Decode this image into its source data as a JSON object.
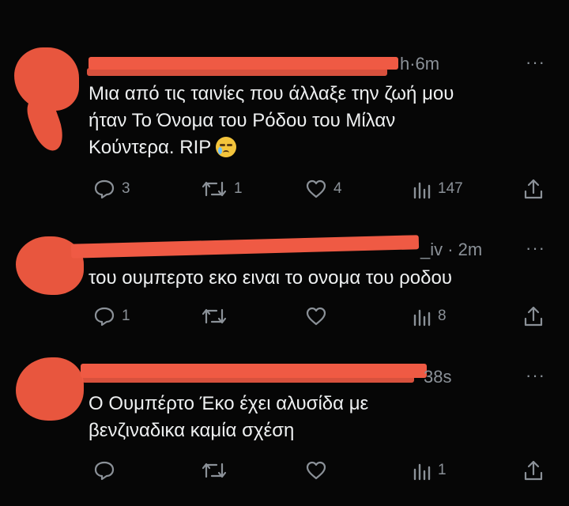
{
  "tweets": [
    {
      "time": "h·6m",
      "more": "···",
      "text_lines": [
        "Μια από τις ταινίες που άλλαξε την ζωή μου",
        "ήταν Το Όνομα του Ρόδου του Μίλαν",
        "Κούντερα. RIP"
      ],
      "emoji": "crying-face",
      "replies": "3",
      "retweets": "1",
      "likes": "4",
      "views": "147"
    },
    {
      "time": "_iv · 2m",
      "more": "···",
      "text_lines": [
        "του ουμπερτο εκο ειναι το ονομα του ροδου"
      ],
      "replies": "1",
      "retweets": "",
      "likes": "",
      "views": "8"
    },
    {
      "time": "38s",
      "more": "···",
      "text_lines": [
        "Ο Ουμπέρτο Έκο έχει αλυσίδα με",
        "βενζιναδικα καμία σχέση"
      ],
      "replies": "",
      "retweets": "",
      "likes": "",
      "views": "1"
    }
  ],
  "colors": {
    "background": "#060606",
    "text": "#eef0f1",
    "muted": "#8b9198",
    "redaction": "#ef5a44"
  },
  "icons": [
    "reply-icon",
    "retweet-icon",
    "like-icon",
    "views-icon",
    "share-icon",
    "more-icon"
  ]
}
